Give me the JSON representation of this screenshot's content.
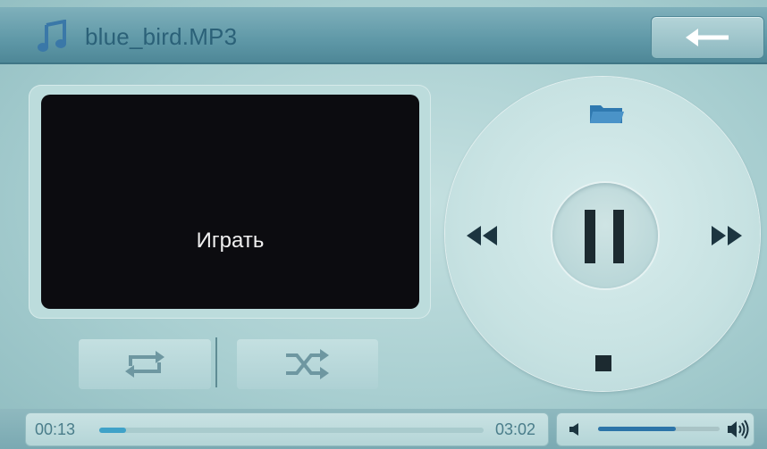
{
  "header": {
    "title": "blue_bird.MP3",
    "music_icon": "music-note-icon",
    "back_icon": "arrow-left-icon"
  },
  "display": {
    "status": "Играть"
  },
  "modes": {
    "repeat_icon": "repeat-icon",
    "shuffle_icon": "shuffle-icon"
  },
  "wheel": {
    "folder_icon": "folder-icon",
    "prev_icon": "rewind-icon",
    "next_icon": "fast-forward-icon",
    "play_pause_icon": "pause-icon",
    "stop_icon": "stop-icon"
  },
  "playback": {
    "elapsed": "00:13",
    "total": "03:02",
    "progress_fraction": 0.07
  },
  "volume": {
    "level_fraction": 0.64,
    "low_icon": "volume-low-icon",
    "high_icon": "volume-high-icon"
  },
  "colors": {
    "accent": "#3fa2c8",
    "title": "#2b6178",
    "background": "#b4d4d6"
  }
}
